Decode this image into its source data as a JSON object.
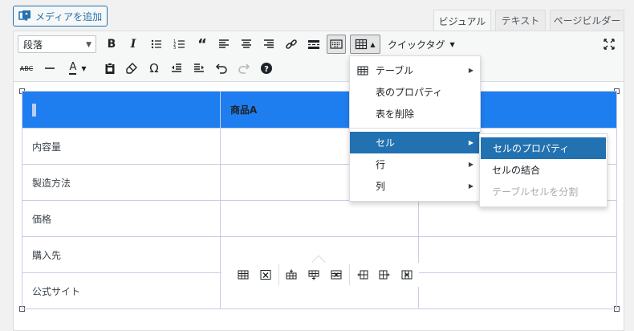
{
  "media_button": {
    "label": "メディアを追加",
    "icon": "media-add-icon"
  },
  "tabs": [
    {
      "label": "ビジュアル",
      "active": true
    },
    {
      "label": "テキスト",
      "active": false
    },
    {
      "label": "ページビルダー",
      "active": false
    }
  ],
  "toolbar": {
    "format_select": "段落",
    "quick_tag": "クイックタグ"
  },
  "table": {
    "header": [
      "",
      "商品A",
      ""
    ],
    "rows": [
      [
        "内容量",
        "",
        ""
      ],
      [
        "製造方法",
        "",
        ""
      ],
      [
        "価格",
        "",
        ""
      ],
      [
        "購入先",
        "",
        ""
      ],
      [
        "公式サイト",
        "",
        ""
      ]
    ]
  },
  "table_menu": {
    "items": [
      "テーブル",
      "表のプロパティ",
      "表を削除",
      "セル",
      "行",
      "列"
    ],
    "highlighted": "セル"
  },
  "cell_submenu": {
    "items": [
      "セルのプロパティ",
      "セルの結合",
      "テーブルセルを分割"
    ],
    "highlighted": "セルのプロパティ",
    "disabled": "テーブルセルを分割"
  },
  "colors": {
    "accent": "#2271b1",
    "header_row": "#1e7ef0",
    "highlight": "#2271b1"
  }
}
